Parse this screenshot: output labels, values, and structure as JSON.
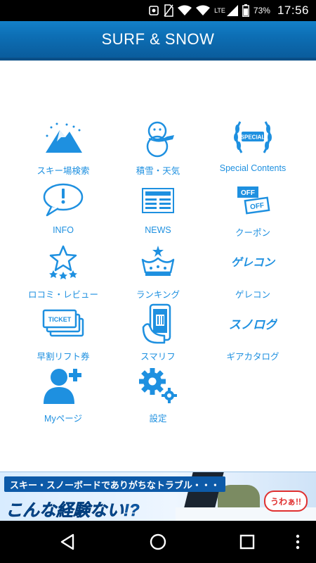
{
  "status_bar": {
    "battery_percent": "73%",
    "time": "17:56",
    "network_label": "LTE"
  },
  "app": {
    "title": "SURF & SNOW"
  },
  "menu": [
    {
      "label": "スキー場検索",
      "icon": "mountain-icon"
    },
    {
      "label": "積雪・天気",
      "icon": "snowman-icon"
    },
    {
      "label": "Special Contents",
      "icon": "special-laurel-icon",
      "badge_text": "SPECIAL"
    },
    {
      "label": "INFO",
      "icon": "speech-bubble-icon"
    },
    {
      "label": "NEWS",
      "icon": "newspaper-icon"
    },
    {
      "label": "クーポン",
      "icon": "coupon-off-icon",
      "badge_text": "OFF"
    },
    {
      "label": "ロコミ・レビュー",
      "icon": "star-review-icon"
    },
    {
      "label": "ランキング",
      "icon": "crown-icon"
    },
    {
      "label": "ゲレコン",
      "icon": "gerekon-logo-icon",
      "logo_text": "ゲレコン"
    },
    {
      "label": "早割リフト券",
      "icon": "tickets-icon",
      "badge_text": "TICKET"
    },
    {
      "label": "スマリフ",
      "icon": "smartphone-qr-icon"
    },
    {
      "label": "ギアカタログ",
      "icon": "snolog-logo-icon",
      "logo_text": "スノログ"
    },
    {
      "label": "Myページ",
      "icon": "user-add-icon"
    },
    {
      "label": "設定",
      "icon": "gears-icon"
    }
  ],
  "banner": {
    "line1": "スキー・スノーボードでありがちなトラブル・・・",
    "line2": "こんな経験ない!?",
    "bubble": "うわぁ!!"
  },
  "colors": {
    "accent": "#1e90e0",
    "header": "#0d6fb5"
  }
}
